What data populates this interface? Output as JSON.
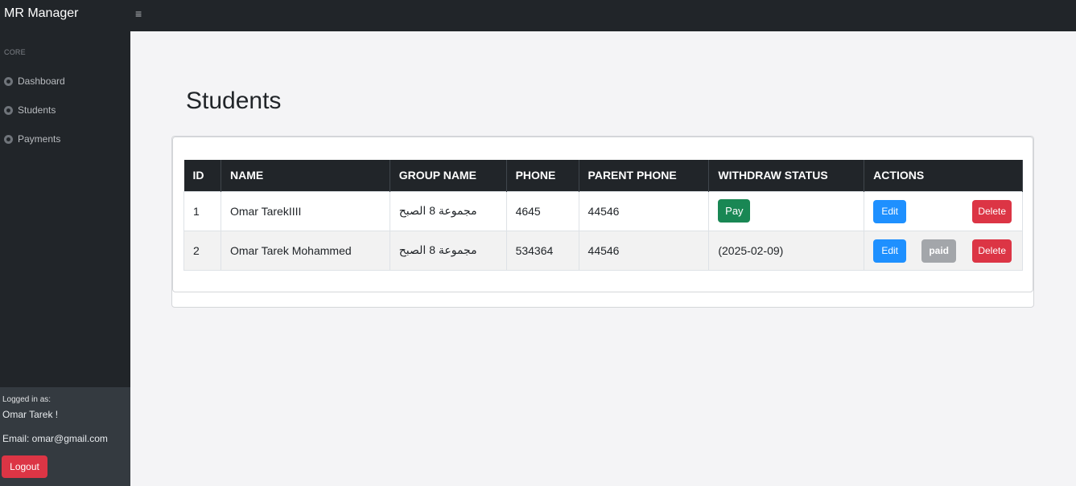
{
  "app": {
    "brand": "MR Manager",
    "menu_toggle": "≡"
  },
  "sidebar": {
    "heading": "CORE",
    "items": [
      {
        "label": "Dashboard",
        "icon": "tachometer-icon"
      },
      {
        "label": "Students",
        "icon": "tachometer-icon"
      },
      {
        "label": "Payments",
        "icon": "tachometer-icon"
      }
    ],
    "footer": {
      "logged_label": "Logged in as:",
      "user_name": "Omar Tarek !",
      "email": "Email: omar@gmail.com",
      "logout_label": "Logout"
    }
  },
  "page": {
    "title": "Students"
  },
  "table": {
    "headers": [
      "ID",
      "NAME",
      "GROUP NAME",
      "PHONE",
      "PARENT PHONE",
      "WITHDRAW STATUS",
      "ACTIONS"
    ],
    "rows": [
      {
        "id": "1",
        "name": "Omar TarekIIII",
        "group": "مجموعة 8 الصبح",
        "phone": "4645",
        "parent_phone": "44546",
        "withdraw_button": "Pay",
        "edit": "Edit",
        "delete": "Delete"
      },
      {
        "id": "2",
        "name": "Omar Tarek Mohammed",
        "group": "مجموعة 8 الصبح",
        "phone": "534364",
        "parent_phone": "44546",
        "withdraw_status": "(2025-02-09)",
        "edit": "Edit",
        "paid": "paid",
        "delete": "Delete"
      }
    ]
  },
  "colors": {
    "sidebar_bg": "#212529",
    "sidebar_footer_bg": "#343a40",
    "primary": "#1e90ff",
    "success": "#198754",
    "danger": "#dc3545",
    "secondary": "#a3a6aa"
  }
}
